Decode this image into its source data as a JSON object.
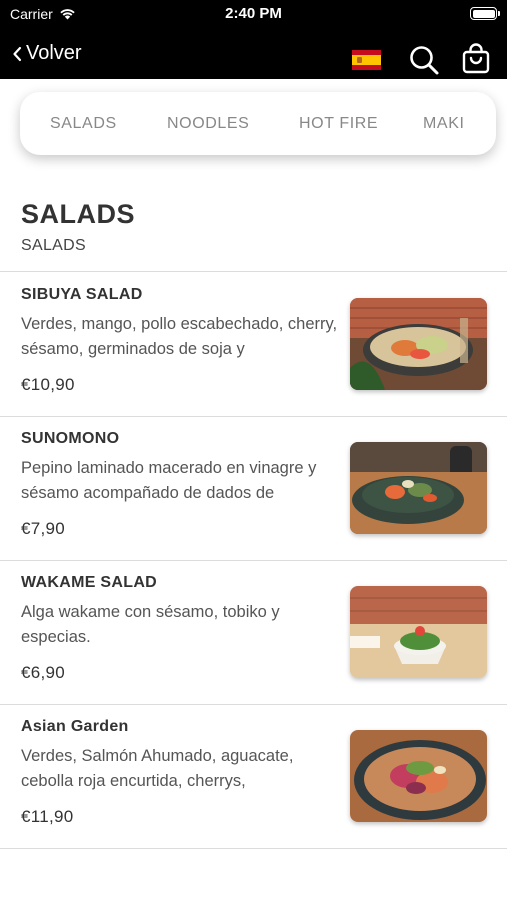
{
  "status_bar": {
    "carrier": "Carrier",
    "time": "2:40 PM"
  },
  "nav": {
    "back_label": "Volver",
    "icons": [
      "chevron-left-icon",
      "spain-flag-icon",
      "search-icon",
      "shopping-bag-icon"
    ]
  },
  "tabs": [
    {
      "label": "SALADS"
    },
    {
      "label": "NOODLES"
    },
    {
      "label": "HOT FIRE"
    },
    {
      "label": "MAKI"
    }
  ],
  "section": {
    "title": "SALADS",
    "subtitle": "SALADS"
  },
  "items": [
    {
      "name": "SIBUYA SALAD",
      "description": "Verdes, mango, pollo escabechado, cherry, sésamo, germinados de soja y",
      "price": "€10,90"
    },
    {
      "name": "SUNOMONO",
      "description": "Pepino laminado macerado en vinagre y sésamo acompañado de dados de",
      "price": "€7,90"
    },
    {
      "name": "WAKAME SALAD",
      "description": "Alga wakame con sésamo, tobiko y especias.",
      "price": "€6,90"
    },
    {
      "name": "Asian Garden",
      "description": "Verdes, Salmón Ahumado, aguacate, cebolla roja encurtida, cherrys,",
      "price": "€11,90"
    }
  ],
  "colors": {
    "header_bg": "#000000",
    "flag_red": "#c60b1e",
    "flag_yellow": "#ffc400",
    "divider": "#dcdcdc",
    "tab_text": "#888888"
  }
}
